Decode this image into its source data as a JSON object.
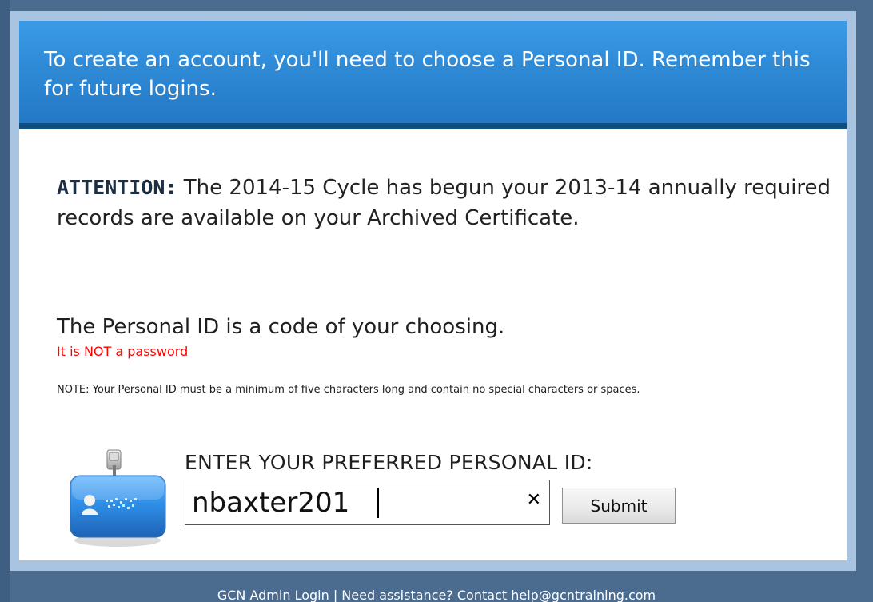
{
  "header": {
    "text": "To create an account, you'll need to choose a Personal ID. Remember this for future logins."
  },
  "attention": {
    "label": "ATTENTION:",
    "text": " The 2014-15 Cycle has begun your 2013-14 annually required records are available on your Archived Certificate."
  },
  "personal_id_info": {
    "title": "The Personal ID is a code of your choosing.",
    "warning": "It is NOT a password",
    "note": "NOTE: Your Personal ID must be a minimum of five characters long and contain no special characters or spaces."
  },
  "form": {
    "label": "ENTER YOUR PREFERRED PERSONAL ID:",
    "input_value": "nbaxter201",
    "clear_symbol": "✕",
    "submit_label": "Submit"
  },
  "footer": {
    "text": "GCN Admin Login | Need assistance? Contact help@gcntraining.com"
  },
  "icons": {
    "id_badge": "id-badge-icon"
  },
  "colors": {
    "header_blue": "#2f8ad6",
    "warning_red": "#ff0000",
    "background": "#4b6c8f"
  }
}
